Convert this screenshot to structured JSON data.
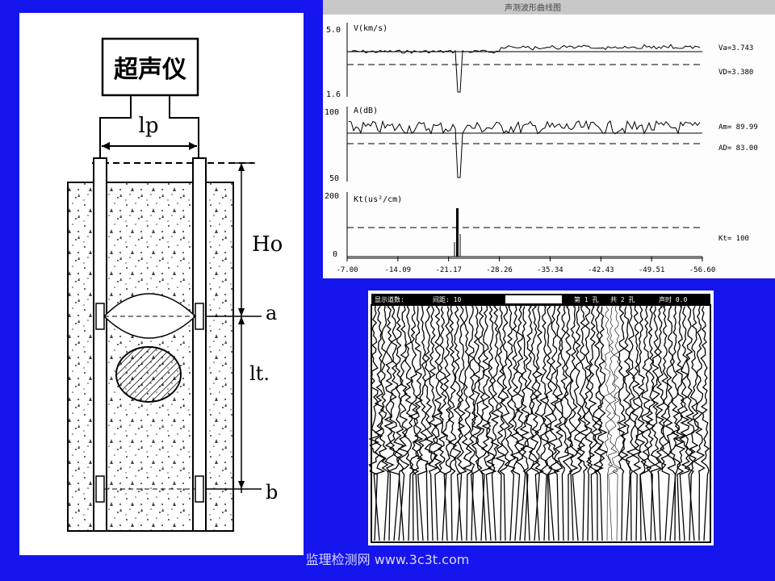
{
  "schematic": {
    "instrument_label": "超声仪",
    "spacing_label": "lp",
    "depth_label": "Ho",
    "top_point_label": "a",
    "length_label": "lt.",
    "bottom_point_label": "b"
  },
  "curves_chart": {
    "title_bar": "声测波形曲线图",
    "v_axis_label": "V(km/s)",
    "v_top": "5.0",
    "v_bottom": "1.6",
    "v_avg_label": "Va=3.743",
    "v_crit_label": "VD=3.380",
    "a_axis_label": "A(dB)",
    "a_top": "100",
    "a_bottom": "50",
    "a_avg_label": "Am= 89.99",
    "a_crit_label": "AD= 83.00",
    "k_axis_label": "Kt(us²/cm)",
    "k_top": "200",
    "k_bottom": "0",
    "k_crit_label": "Kt= 100",
    "x_ticks": [
      "-7.00",
      "-14.09",
      "-21.17",
      "-28.26",
      "-35.34",
      "-42.43",
      "-49.51",
      "-56.60"
    ]
  },
  "waveform": {
    "header_left": "显示道数:",
    "header_mid": "间距: 10",
    "header_r1": "第 1 孔",
    "header_r2": "共 2 孔",
    "header_r3": "声时 0.0"
  },
  "footer": {
    "text": "监理检测网 www.3c3t.com"
  },
  "colors": {
    "background": "#1515ee",
    "panel": "#ffffff",
    "ink": "#000000"
  }
}
